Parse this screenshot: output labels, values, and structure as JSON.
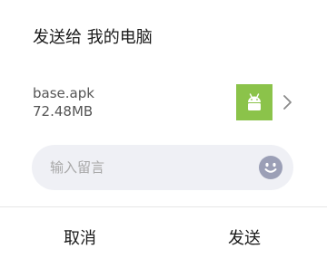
{
  "dialog": {
    "title": "发送给 我的电脑",
    "file": {
      "name": "base.apk",
      "size": "72.48MB",
      "thumb_icon": "android-icon",
      "thumb_color": "#8bc34a"
    },
    "message": {
      "placeholder": "输入留言",
      "value": "",
      "emoji_icon": "smiley-icon"
    },
    "buttons": {
      "cancel": "取消",
      "send": "发送"
    },
    "colors": {
      "accent": "#3b7ddd",
      "input_bg": "#eff0f5",
      "emoji": "#9b9fb6"
    }
  }
}
